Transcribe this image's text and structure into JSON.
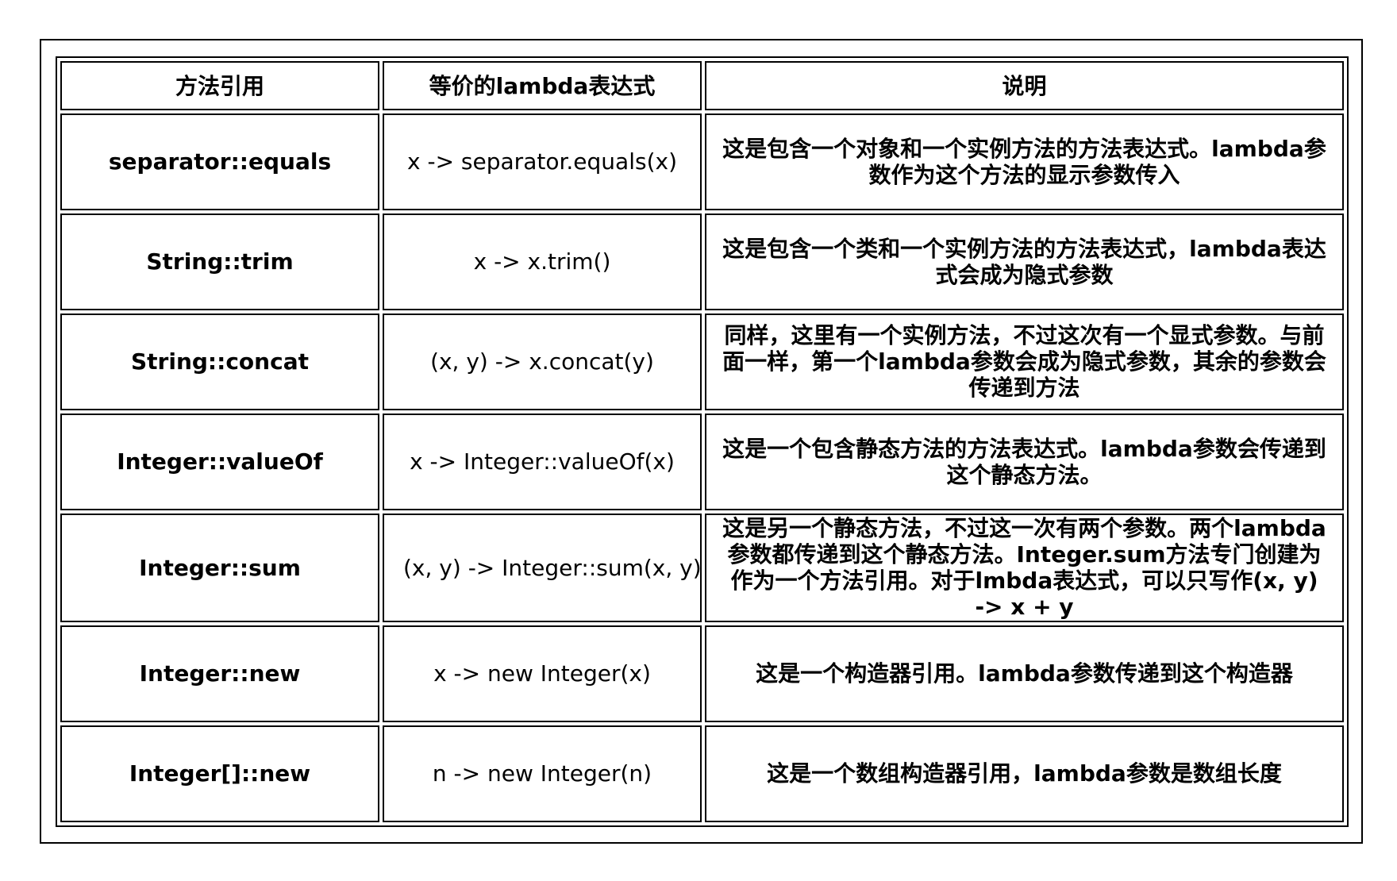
{
  "table": {
    "headers": [
      "方法引用",
      "等价的lambda表达式",
      "说明"
    ],
    "rows": [
      {
        "method_ref": "separator::equals",
        "lambda": "x -> separator.equals(x)",
        "description": "这是包含一个对象和一个实例方法的方法表达式。lambda参数作为这个方法的显示参数传入"
      },
      {
        "method_ref": "String::trim",
        "lambda": "x -> x.trim()",
        "description": "这是包含一个类和一个实例方法的方法表达式，lambda表达式会成为隐式参数"
      },
      {
        "method_ref": "String::concat",
        "lambda": "(x, y) -> x.concat(y)",
        "description": "同样，这里有一个实例方法，不过这次有一个显式参数。与前面一样，第一个lambda参数会成为隐式参数，其余的参数会传递到方法"
      },
      {
        "method_ref": "Integer::valueOf",
        "lambda": "x -> Integer::valueOf(x)",
        "description": "这是一个包含静态方法的方法表达式。lambda参数会传递到这个静态方法。"
      },
      {
        "method_ref": "Integer::sum",
        "lambda": "(x, y) -> Integer::sum(x, y)",
        "description": "这是另一个静态方法，不过这一次有两个参数。两个lambda参数都传递到这个静态方法。Integer.sum方法专门创建为作为一个方法引用。对于lmbda表达式，可以只写作(x, y) -> x + y"
      },
      {
        "method_ref": "Integer::new",
        "lambda": "x -> new Integer(x)",
        "description": "这是一个构造器引用。lambda参数传递到这个构造器"
      },
      {
        "method_ref": "Integer[]::new",
        "lambda": "n -> new Integer(n)",
        "description": "这是一个数组构造器引用，lambda参数是数组长度"
      }
    ]
  }
}
